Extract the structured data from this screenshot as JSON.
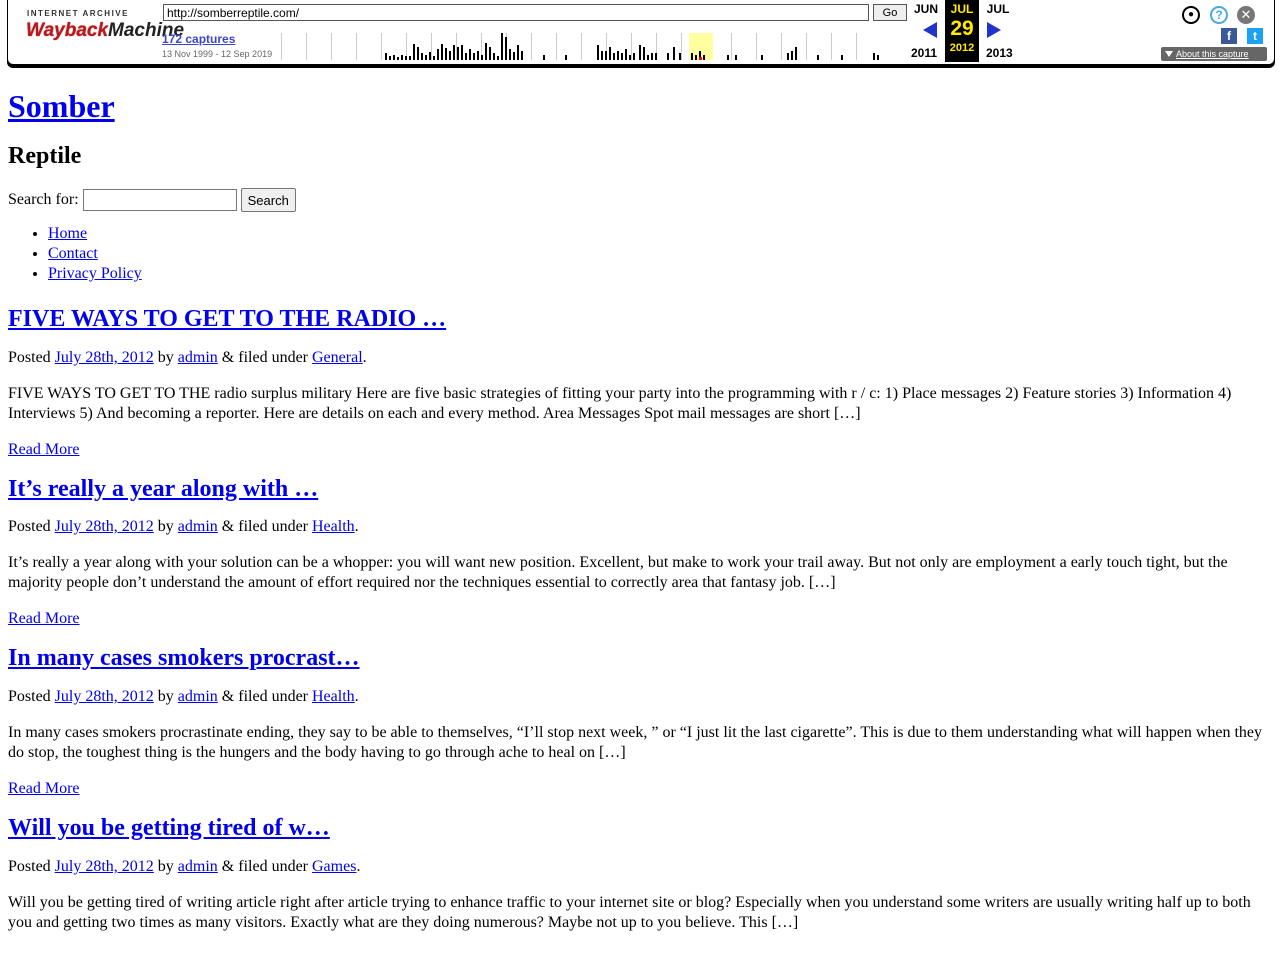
{
  "toolbar": {
    "logo_top": "INTERNET ARCHIVE",
    "logo_wayback": "Wayback",
    "logo_machine": "Machine",
    "url_value": "http://somberreptile.com/",
    "go_label": "Go",
    "captures_label": "172 captures",
    "capture_range": "13 Nov 1999 - 12 Sep 2019",
    "prev_month": "JUN",
    "current_month": "JUL",
    "next_month": "JUL",
    "current_day": "29",
    "prev_year": "2011",
    "current_year": "2012",
    "next_year": "2013",
    "about_capture": "About this capture",
    "icons": [
      "user-icon",
      "help-icon",
      "close-icon",
      "facebook-icon",
      "twitter-icon",
      "prev-arrow-icon",
      "next-arrow-icon"
    ],
    "colors": {
      "highlight": "#ffea00",
      "arrow": "#2233cc",
      "logo_red": "#b8191e"
    }
  },
  "site": {
    "title": "Somber",
    "description": "Reptile"
  },
  "search": {
    "label": "Search for:",
    "value": "",
    "button": "Search"
  },
  "nav": {
    "items": [
      "Home",
      "Contact",
      "Privacy Policy"
    ]
  },
  "posts": [
    {
      "title": "FIVE WAYS TO GET TO THE RADIO …",
      "meta_prefix": "Posted",
      "date": "July 28th, 2012",
      "by": "by",
      "author": "admin",
      "filed": "& filed under",
      "category": "General",
      "excerpt": "FIVE WAYS TO GET TO THE radio surplus military Here are five basic strategies of fitting your party into the programming with r / c: 1) Place messages 2) Feature stories 3) Information 4) Interviews 5) And becoming a reporter. Here are details on each and every method. Area Messages Spot mail messages are short […]",
      "read_more": "Read More"
    },
    {
      "title": "It’s really a year along with …",
      "meta_prefix": "Posted",
      "date": "July 28th, 2012",
      "by": "by",
      "author": "admin",
      "filed": "& filed under",
      "category": "Health",
      "excerpt": "It’s really a year along with your solution can be a whopper: you will want new position. Excellent, but make to work your trail away. But not only are employment a early touch tight, but the majority people don’t understand the amount of effort required nor the techniques essential to correctly area that fantasy job. […]",
      "read_more": "Read More"
    },
    {
      "title": "In many cases smokers procrast…",
      "meta_prefix": "Posted",
      "date": "July 28th, 2012",
      "by": "by",
      "author": "admin",
      "filed": "& filed under",
      "category": "Health",
      "excerpt": "In many cases smokers procrastinate ending, they say to be able to themselves, “I’ll stop next week, ” or “I just lit the last cigarette”. This is due to them understanding what will happen when they do stop, the toughest thing is the hungers and the body having to go through ache to heal on […]",
      "read_more": "Read More"
    },
    {
      "title": "Will you be getting tired of w…",
      "meta_prefix": "Posted",
      "date": "July 28th, 2012",
      "by": "by",
      "author": "admin",
      "filed": "& filed under",
      "category": "Games",
      "excerpt": "Will you be getting tired of writing article right after article trying to enhance traffic to your internet site or blog? Especially when you understand some writers are usually writing half up to both you and getting two times as many visitors. Exactly what are they doing numerous? Maybe not up to you believe. This […]",
      "read_more": "Read More"
    }
  ]
}
